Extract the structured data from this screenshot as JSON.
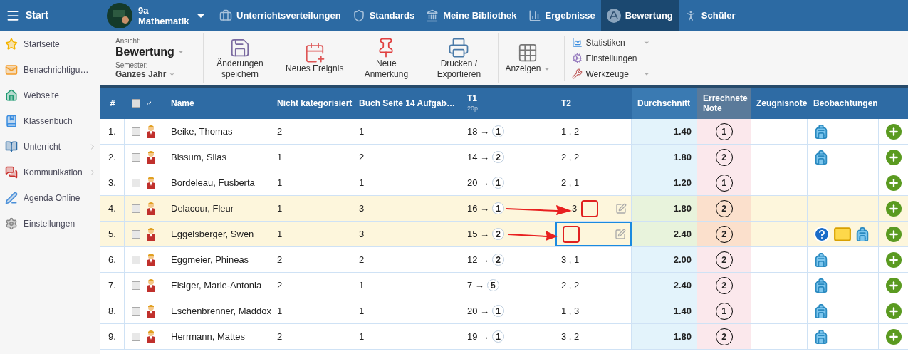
{
  "topbar": {
    "menu_label": "Start",
    "class_name": "9a",
    "subject": "Mathematik",
    "tabs": [
      {
        "label": "Unterrichtsverteilungen",
        "kind": "briefcase",
        "selected": false
      },
      {
        "label": "Standards",
        "kind": "shield",
        "selected": false
      },
      {
        "label": "Meine Bibliothek",
        "kind": "library",
        "selected": false
      },
      {
        "label": "Ergebnisse",
        "kind": "chart",
        "selected": false
      },
      {
        "label": "Bewertung",
        "kind": "grade",
        "selected": true
      },
      {
        "label": "Schüler",
        "kind": "walk",
        "selected": false
      }
    ]
  },
  "sidebar": {
    "items": [
      {
        "label": "Startseite",
        "kind": "star",
        "has_submenu": false
      },
      {
        "label": "Benachrichtigu…",
        "kind": "mail",
        "has_submenu": false
      },
      {
        "label": "Webseite",
        "kind": "home",
        "has_submenu": false
      },
      {
        "label": "Klassenbuch",
        "kind": "book",
        "has_submenu": false
      },
      {
        "label": "Unterricht",
        "kind": "open-book",
        "has_submenu": true
      },
      {
        "label": "Kommunikation",
        "kind": "chat",
        "has_submenu": true
      },
      {
        "label": "Agenda Online",
        "kind": "pen",
        "has_submenu": false
      },
      {
        "label": "Einstellungen",
        "kind": "gear",
        "has_submenu": false
      }
    ]
  },
  "toolbar": {
    "view_label": "Ansicht:",
    "view_value": "Bewertung",
    "semester_label": "Semester:",
    "semester_value": "Ganzes Jahr",
    "buttons": [
      {
        "label": "Änderungen speichern",
        "kind": "save"
      },
      {
        "label": "Neues Ereignis",
        "kind": "calendar"
      },
      {
        "label": "Neue Anmerkung",
        "kind": "pin"
      },
      {
        "label": "Drucken / Exportieren",
        "kind": "print"
      },
      {
        "label": "Anzeigen",
        "kind": "grid"
      }
    ],
    "menu": [
      {
        "label": "Statistiken",
        "kind": "stats",
        "has_dropdown": true
      },
      {
        "label": "Einstellungen",
        "kind": "gears",
        "has_dropdown": false
      },
      {
        "label": "Werkzeuge",
        "kind": "tools",
        "has_dropdown": true
      }
    ]
  },
  "table": {
    "select_all_checked": false,
    "columns": [
      {
        "label": "#"
      },
      {
        "label": "♂"
      },
      {
        "label": "Name"
      },
      {
        "label": "Nicht kategorisiert"
      },
      {
        "label": "Buch Seite 14 Aufgab…"
      },
      {
        "label": "T1",
        "sub": "20p"
      },
      {
        "label": "T2"
      },
      {
        "label": "Durchschnitt"
      },
      {
        "label": "Errechnete Note"
      },
      {
        "label": "Zeugnisnote"
      },
      {
        "label": "Beobachtungen"
      }
    ],
    "rows": [
      {
        "num": "1.",
        "name": "Beike, Thomas",
        "c1": "2",
        "c2": "1",
        "t1": "18 →",
        "t1_grade": "1",
        "t2": "1 , 2",
        "avg": "1.40",
        "grade": "1",
        "has_question": false,
        "has_message": false,
        "has_backpack": true,
        "highlighted": false,
        "editing": false,
        "annotated": false
      },
      {
        "num": "2.",
        "name": "Bissum, Silas",
        "c1": "1",
        "c2": "2",
        "t1": "14 →",
        "t1_grade": "2",
        "t2": "2 , 2",
        "avg": "1.80",
        "grade": "2",
        "has_question": false,
        "has_message": false,
        "has_backpack": true,
        "highlighted": false,
        "editing": false,
        "annotated": false
      },
      {
        "num": "3.",
        "name": "Bordeleau, Fusberta",
        "c1": "1",
        "c2": "1",
        "t1": "20 →",
        "t1_grade": "1",
        "t2": "2 , 1",
        "avg": "1.20",
        "grade": "1",
        "has_question": false,
        "has_message": false,
        "has_backpack": false,
        "highlighted": false,
        "editing": false,
        "annotated": false
      },
      {
        "num": "4.",
        "name": "Delacour, Fleur",
        "c1": "1",
        "c2": "3",
        "t1": "16 →",
        "t1_grade": "1",
        "t2": "3",
        "avg": "1.80",
        "grade": "2",
        "has_question": false,
        "has_message": false,
        "has_backpack": false,
        "highlighted": true,
        "editing": false,
        "annotated": true
      },
      {
        "num": "5.",
        "name": "Eggelsberger, Swen",
        "c1": "1",
        "c2": "3",
        "t1": "15 →",
        "t1_grade": "2",
        "avg": "2.40",
        "grade": "2",
        "has_question": true,
        "has_message": true,
        "has_backpack": true,
        "highlighted": true,
        "editing": true,
        "annotated": true
      },
      {
        "num": "6.",
        "name": "Eggmeier, Phineas",
        "c1": "2",
        "c2": "2",
        "t1": "12 →",
        "t1_grade": "2",
        "t2": "3 , 1",
        "avg": "2.00",
        "grade": "2",
        "has_question": false,
        "has_message": false,
        "has_backpack": true,
        "highlighted": false,
        "editing": false,
        "annotated": false
      },
      {
        "num": "7.",
        "name": "Eisiger, Marie-Antonia",
        "c1": "2",
        "c2": "1",
        "t1": "7 →",
        "t1_grade": "5",
        "t2": "2 , 2",
        "avg": "2.40",
        "grade": "2",
        "has_question": false,
        "has_message": false,
        "has_backpack": true,
        "highlighted": false,
        "editing": false,
        "annotated": false
      },
      {
        "num": "8.",
        "name": "Eschenbrenner, Maddox",
        "c1": "1",
        "c2": "1",
        "t1": "20 →",
        "t1_grade": "1",
        "t2": "1 , 3",
        "avg": "1.40",
        "grade": "1",
        "has_question": false,
        "has_message": false,
        "has_backpack": true,
        "highlighted": false,
        "editing": false,
        "annotated": false
      },
      {
        "num": "9.",
        "name": "Herrmann, Mattes",
        "c1": "2",
        "c2": "1",
        "t1": "19 →",
        "t1_grade": "1",
        "t2": "3 , 2",
        "avg": "1.80",
        "grade": "2",
        "has_question": false,
        "has_message": false,
        "has_backpack": true,
        "highlighted": false,
        "editing": false,
        "annotated": false
      }
    ]
  }
}
